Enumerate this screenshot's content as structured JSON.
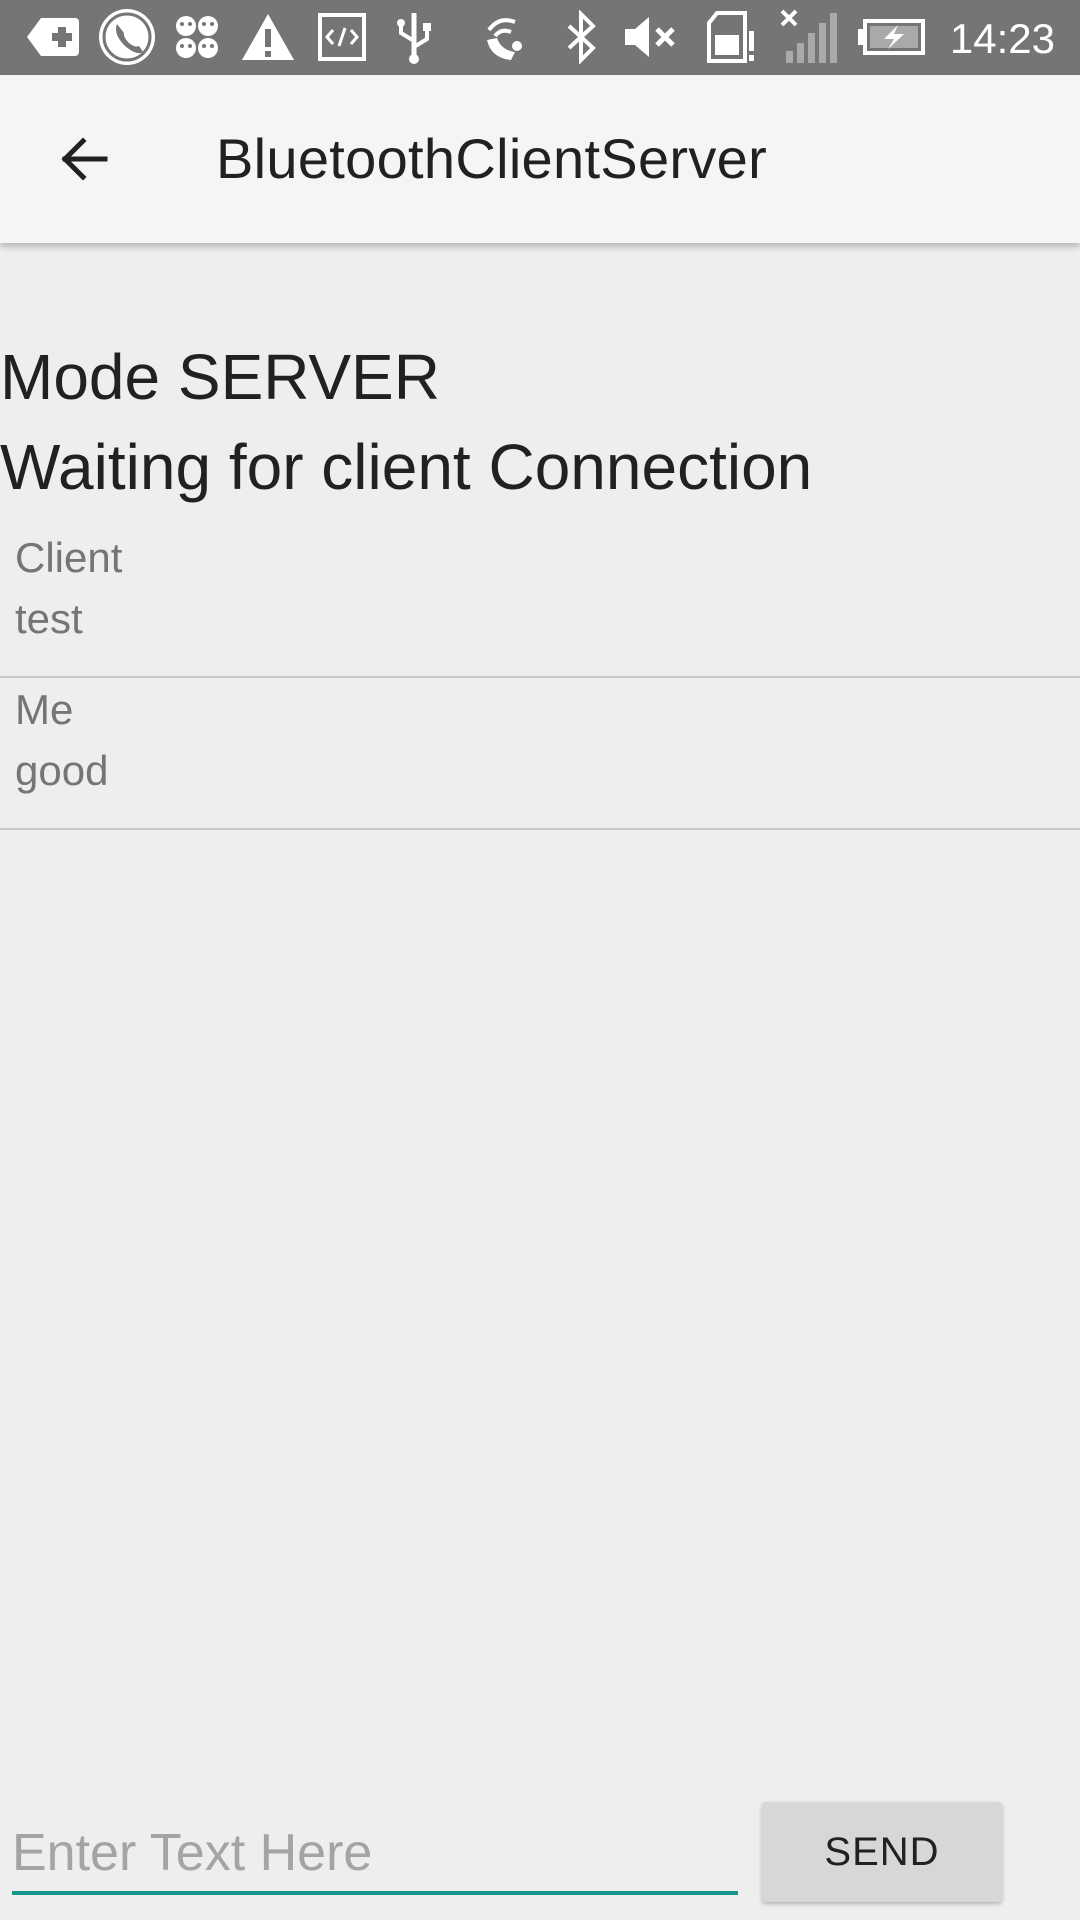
{
  "status_bar": {
    "time": "14:23",
    "icons": [
      "add-box-icon",
      "phone-off-icon",
      "emoji-faces-icon",
      "warning-icon",
      "code-icon",
      "usb-icon",
      "wifi-hotspot-icon",
      "bluetooth-icon",
      "volume-muted-icon",
      "sd-card-alert-icon",
      "signal-off-icon",
      "battery-charging-icon"
    ],
    "background_color": "#757575"
  },
  "app_bar": {
    "title": "BluetoothClientServer",
    "back_icon": "arrow-back-icon"
  },
  "content": {
    "mode_text": "Mode SERVER",
    "connection_status": "Waiting for client Connection"
  },
  "messages": [
    {
      "sender": "Client",
      "text": "test"
    },
    {
      "sender": "Me",
      "text": "good"
    }
  ],
  "composer": {
    "input_value": "",
    "input_placeholder": "Enter Text Here",
    "send_label": "SEND",
    "accent_color": "#149688"
  }
}
